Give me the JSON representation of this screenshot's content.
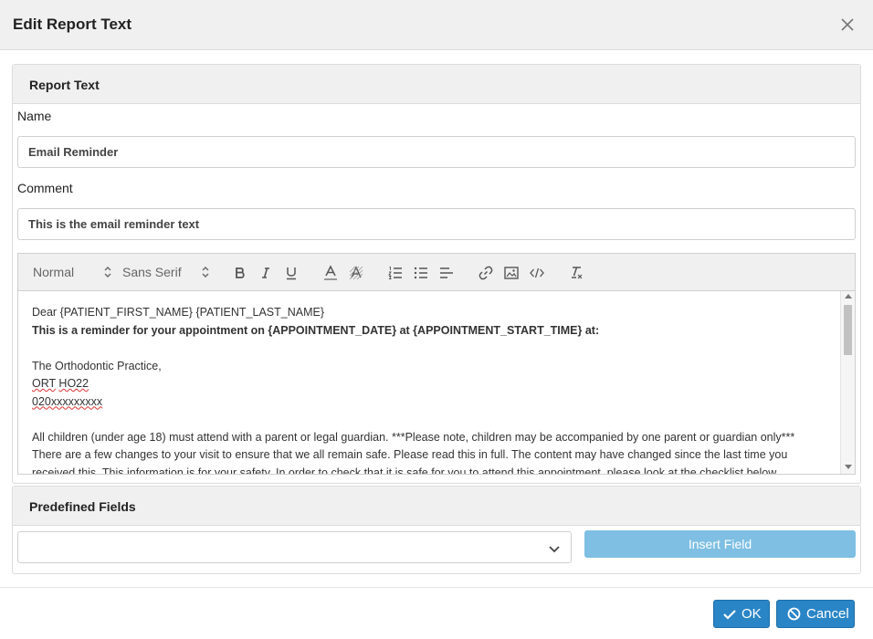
{
  "dialog": {
    "title": "Edit Report Text"
  },
  "report_text": {
    "heading": "Report Text",
    "name_label": "Name",
    "name_value": "Email Reminder",
    "comment_label": "Comment",
    "comment_value": "This is the email reminder text"
  },
  "editor": {
    "toolbar": {
      "format_select": "Normal",
      "font_select": "Sans Serif",
      "icons": [
        "bold-icon",
        "italic-icon",
        "underline-icon",
        "font-color-icon",
        "background-color-icon",
        "ordered-list-icon",
        "bullet-list-icon",
        "align-icon",
        "link-icon",
        "image-icon",
        "code-icon",
        "clear-format-icon"
      ]
    },
    "lines": {
      "l1": "Dear {PATIENT_FIRST_NAME} {PATIENT_LAST_NAME}",
      "l2": "This is a reminder for your appointment on {APPOINTMENT_DATE} at {APPOINTMENT_START_TIME} at:",
      "l3": "The Orthodontic Practice,",
      "l4a": "ORT",
      "l4b": "HO22",
      "l5": "020xxxxxxxxx",
      "l6": "All children (under age 18) must attend with a parent or legal guardian. ***Please note, children may be accompanied by one parent or guardian only***",
      "l7": "There are a few changes to your visit to ensure that we all remain safe. Please read this in full. The content may have changed since the last time you",
      "l8": "received this. This information is for your safety. In order to check that it is safe for you to attend this appointment, please look at the checklist below."
    }
  },
  "predefined": {
    "heading": "Predefined Fields",
    "select_value": "",
    "insert_label": "Insert Field"
  },
  "footer": {
    "ok_label": "OK",
    "cancel_label": "Cancel"
  },
  "colors": {
    "primary": "#2a85c6",
    "insert_disabled": "#7ebfe3",
    "header_bg": "#f0f0f0"
  }
}
